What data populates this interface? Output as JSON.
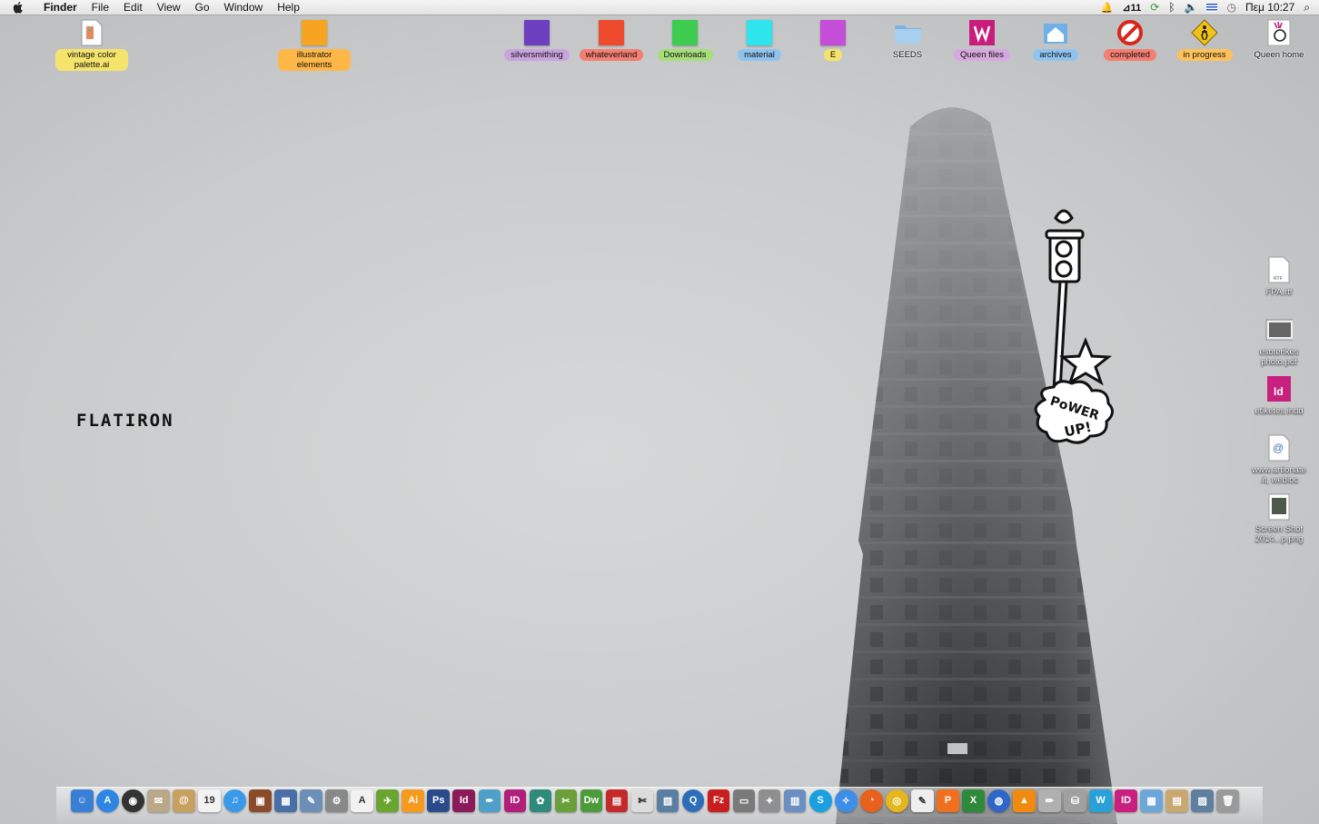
{
  "menubar": {
    "app": "Finder",
    "items": [
      "File",
      "Edit",
      "View",
      "Go",
      "Window",
      "Help"
    ],
    "adobe_count": "11",
    "clock": "Πεμ 10:27"
  },
  "desktop_top_icons": [
    {
      "label": "vintage color palette.ai",
      "color": "#f5e46b",
      "kind": "file"
    },
    {
      "label": "illustrator elements",
      "color": "#ffb848",
      "kind": "folder",
      "swatch": "#f7a520"
    },
    {
      "label": "silversmithing",
      "color": "#c9a3dc",
      "kind": "folder",
      "swatch": "#6b3fbf"
    },
    {
      "label": "whateverland",
      "color": "#f47e72",
      "kind": "folder",
      "swatch": "#ee4b2e"
    },
    {
      "label": "Downloads",
      "color": "#a6df7a",
      "kind": "folder",
      "swatch": "#3dcc4f"
    },
    {
      "label": "material",
      "color": "#8fc3ef",
      "kind": "folder",
      "swatch": "#2ee5ee"
    },
    {
      "label": "E",
      "color": "#f5e46b",
      "kind": "folder",
      "swatch": "#c54ed8"
    },
    {
      "label": "SEEDS",
      "color": "",
      "kind": "folder-blue"
    },
    {
      "label": "Queen files",
      "color": "#d7a7e0",
      "kind": "queen"
    },
    {
      "label": "archives",
      "color": "#8fc3ef",
      "kind": "home"
    },
    {
      "label": "completed",
      "color": "#f47e72",
      "kind": "forbidden"
    },
    {
      "label": "in progress",
      "color": "#ffc25a",
      "kind": "caution"
    },
    {
      "label": "Queen home",
      "color": "",
      "kind": "queenhome"
    }
  ],
  "desktop_right_icons": [
    {
      "label": "FPA.rtf",
      "kind": "rtf"
    },
    {
      "label": "esoterikes photo.pdf",
      "kind": "photo"
    },
    {
      "label": "etiketes.indd",
      "kind": "indd"
    },
    {
      "label": "www.artionate .it, webloc",
      "kind": "webloc"
    },
    {
      "label": "Screen Shot 2014...p.png",
      "kind": "shot"
    }
  ],
  "wallpaper_text": "FLATIRON",
  "sticker_text": "PoWER UP!",
  "dock": [
    {
      "name": "finder-icon",
      "bg": "#3a7fd6",
      "glyph": "☺"
    },
    {
      "name": "app-store-icon",
      "bg": "#2d86e6",
      "glyph": "A",
      "round": true
    },
    {
      "name": "dashboard-icon",
      "bg": "#333",
      "glyph": "◉",
      "round": true
    },
    {
      "name": "mail-stamp-icon",
      "bg": "#b9a88a",
      "glyph": "✉"
    },
    {
      "name": "contacts-icon",
      "bg": "#c8a060",
      "glyph": "@"
    },
    {
      "name": "calendar-icon",
      "bg": "#f2f2f2",
      "glyph": "19",
      "dark": true
    },
    {
      "name": "itunes-icon",
      "bg": "#3b9ae8",
      "glyph": "♫",
      "round": true
    },
    {
      "name": "photo-booth-icon",
      "bg": "#8a4b2b",
      "glyph": "▣"
    },
    {
      "name": "mission-control-icon",
      "bg": "#4a6ea6",
      "glyph": "▦"
    },
    {
      "name": "preview-icon",
      "bg": "#6c8fb8",
      "glyph": "✎"
    },
    {
      "name": "system-preferences-icon",
      "bg": "#888",
      "glyph": "⚙"
    },
    {
      "name": "acrobat-icon",
      "bg": "#f2f2f2",
      "glyph": "A",
      "dark": true
    },
    {
      "name": "transmit-icon",
      "bg": "#6aa52f",
      "glyph": "✈"
    },
    {
      "name": "illustrator-icon",
      "bg": "#f59a1e",
      "glyph": "Ai"
    },
    {
      "name": "photoshop-icon",
      "bg": "#2a4a8a",
      "glyph": "Ps"
    },
    {
      "name": "indesign-icon",
      "bg": "#8a1a5a",
      "glyph": "Id"
    },
    {
      "name": "feather-icon",
      "bg": "#4ea0c8",
      "glyph": "✒"
    },
    {
      "name": "indesign-cs-icon",
      "bg": "#b0207a",
      "glyph": "ID"
    },
    {
      "name": "bridge-icon",
      "bg": "#2e8a7a",
      "glyph": "✿"
    },
    {
      "name": "utilities-icon",
      "bg": "#6aa03c",
      "glyph": "✂"
    },
    {
      "name": "dreamweaver-icon",
      "bg": "#4c9b3a",
      "glyph": "Dw"
    },
    {
      "name": "book-icon",
      "bg": "#c42a2a",
      "glyph": "▤"
    },
    {
      "name": "script-icon",
      "bg": "#dcdcdc",
      "glyph": "✄",
      "dark": true
    },
    {
      "name": "image-capture-icon",
      "bg": "#5a7fa0",
      "glyph": "▧"
    },
    {
      "name": "quicktime-icon",
      "bg": "#2c6fb8",
      "glyph": "Q",
      "round": true
    },
    {
      "name": "filezilla-icon",
      "bg": "#c81e1e",
      "glyph": "Fz"
    },
    {
      "name": "scanner-icon",
      "bg": "#7a7a7a",
      "glyph": "▭"
    },
    {
      "name": "compass-tool-icon",
      "bg": "#8f8f8f",
      "glyph": "✦"
    },
    {
      "name": "stack-icon",
      "bg": "#6b8fc0",
      "glyph": "▥"
    },
    {
      "name": "skype-icon",
      "bg": "#1aa0e0",
      "glyph": "S",
      "round": true
    },
    {
      "name": "safari-icon",
      "bg": "#3d8ee6",
      "glyph": "✧",
      "round": true
    },
    {
      "name": "firefox-icon",
      "bg": "#e8601c",
      "glyph": "◔",
      "round": true
    },
    {
      "name": "chrome-icon",
      "bg": "#e6b71c",
      "glyph": "◎",
      "round": true
    },
    {
      "name": "textedit-icon",
      "bg": "#eeeeee",
      "glyph": "✎",
      "dark": true
    },
    {
      "name": "pages-icon",
      "bg": "#f07020",
      "glyph": "P"
    },
    {
      "name": "excel-icon",
      "bg": "#2e8a3a",
      "glyph": "X"
    },
    {
      "name": "google-earth-icon",
      "bg": "#2f66c8",
      "glyph": "◍",
      "round": true
    },
    {
      "name": "vlc-icon",
      "bg": "#f08a10",
      "glyph": "▲"
    },
    {
      "name": "pencil-tool-icon",
      "bg": "#b0b0b0",
      "glyph": "✏"
    },
    {
      "name": "disk-utility-icon",
      "bg": "#a0a0a0",
      "glyph": "⛁"
    },
    {
      "name": "wordpress-icon",
      "bg": "#2aa0d8",
      "glyph": "W"
    },
    {
      "name": "indesign-doc-icon",
      "bg": "#c8207e",
      "glyph": "ID"
    },
    {
      "name": "folder-stack-icon",
      "bg": "#6fa6d8",
      "glyph": "▦"
    },
    {
      "name": "documents-stack-icon",
      "bg": "#c8a870",
      "glyph": "▤"
    },
    {
      "name": "downloads-stack-icon",
      "bg": "#5f7f9f",
      "glyph": "▨"
    },
    {
      "name": "trash-icon",
      "bg": "#9a9a9a",
      "glyph": "🗑"
    }
  ]
}
